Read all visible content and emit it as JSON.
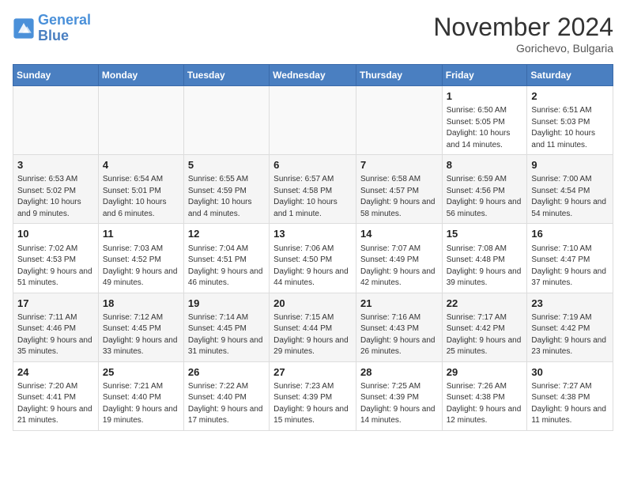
{
  "header": {
    "logo_line1": "General",
    "logo_line2": "Blue",
    "month_title": "November 2024",
    "location": "Gorichevo, Bulgaria"
  },
  "weekdays": [
    "Sunday",
    "Monday",
    "Tuesday",
    "Wednesday",
    "Thursday",
    "Friday",
    "Saturday"
  ],
  "weeks": [
    [
      {
        "day": "",
        "info": ""
      },
      {
        "day": "",
        "info": ""
      },
      {
        "day": "",
        "info": ""
      },
      {
        "day": "",
        "info": ""
      },
      {
        "day": "",
        "info": ""
      },
      {
        "day": "1",
        "info": "Sunrise: 6:50 AM\nSunset: 5:05 PM\nDaylight: 10 hours and 14 minutes."
      },
      {
        "day": "2",
        "info": "Sunrise: 6:51 AM\nSunset: 5:03 PM\nDaylight: 10 hours and 11 minutes."
      }
    ],
    [
      {
        "day": "3",
        "info": "Sunrise: 6:53 AM\nSunset: 5:02 PM\nDaylight: 10 hours and 9 minutes."
      },
      {
        "day": "4",
        "info": "Sunrise: 6:54 AM\nSunset: 5:01 PM\nDaylight: 10 hours and 6 minutes."
      },
      {
        "day": "5",
        "info": "Sunrise: 6:55 AM\nSunset: 4:59 PM\nDaylight: 10 hours and 4 minutes."
      },
      {
        "day": "6",
        "info": "Sunrise: 6:57 AM\nSunset: 4:58 PM\nDaylight: 10 hours and 1 minute."
      },
      {
        "day": "7",
        "info": "Sunrise: 6:58 AM\nSunset: 4:57 PM\nDaylight: 9 hours and 58 minutes."
      },
      {
        "day": "8",
        "info": "Sunrise: 6:59 AM\nSunset: 4:56 PM\nDaylight: 9 hours and 56 minutes."
      },
      {
        "day": "9",
        "info": "Sunrise: 7:00 AM\nSunset: 4:54 PM\nDaylight: 9 hours and 54 minutes."
      }
    ],
    [
      {
        "day": "10",
        "info": "Sunrise: 7:02 AM\nSunset: 4:53 PM\nDaylight: 9 hours and 51 minutes."
      },
      {
        "day": "11",
        "info": "Sunrise: 7:03 AM\nSunset: 4:52 PM\nDaylight: 9 hours and 49 minutes."
      },
      {
        "day": "12",
        "info": "Sunrise: 7:04 AM\nSunset: 4:51 PM\nDaylight: 9 hours and 46 minutes."
      },
      {
        "day": "13",
        "info": "Sunrise: 7:06 AM\nSunset: 4:50 PM\nDaylight: 9 hours and 44 minutes."
      },
      {
        "day": "14",
        "info": "Sunrise: 7:07 AM\nSunset: 4:49 PM\nDaylight: 9 hours and 42 minutes."
      },
      {
        "day": "15",
        "info": "Sunrise: 7:08 AM\nSunset: 4:48 PM\nDaylight: 9 hours and 39 minutes."
      },
      {
        "day": "16",
        "info": "Sunrise: 7:10 AM\nSunset: 4:47 PM\nDaylight: 9 hours and 37 minutes."
      }
    ],
    [
      {
        "day": "17",
        "info": "Sunrise: 7:11 AM\nSunset: 4:46 PM\nDaylight: 9 hours and 35 minutes."
      },
      {
        "day": "18",
        "info": "Sunrise: 7:12 AM\nSunset: 4:45 PM\nDaylight: 9 hours and 33 minutes."
      },
      {
        "day": "19",
        "info": "Sunrise: 7:14 AM\nSunset: 4:45 PM\nDaylight: 9 hours and 31 minutes."
      },
      {
        "day": "20",
        "info": "Sunrise: 7:15 AM\nSunset: 4:44 PM\nDaylight: 9 hours and 29 minutes."
      },
      {
        "day": "21",
        "info": "Sunrise: 7:16 AM\nSunset: 4:43 PM\nDaylight: 9 hours and 26 minutes."
      },
      {
        "day": "22",
        "info": "Sunrise: 7:17 AM\nSunset: 4:42 PM\nDaylight: 9 hours and 25 minutes."
      },
      {
        "day": "23",
        "info": "Sunrise: 7:19 AM\nSunset: 4:42 PM\nDaylight: 9 hours and 23 minutes."
      }
    ],
    [
      {
        "day": "24",
        "info": "Sunrise: 7:20 AM\nSunset: 4:41 PM\nDaylight: 9 hours and 21 minutes."
      },
      {
        "day": "25",
        "info": "Sunrise: 7:21 AM\nSunset: 4:40 PM\nDaylight: 9 hours and 19 minutes."
      },
      {
        "day": "26",
        "info": "Sunrise: 7:22 AM\nSunset: 4:40 PM\nDaylight: 9 hours and 17 minutes."
      },
      {
        "day": "27",
        "info": "Sunrise: 7:23 AM\nSunset: 4:39 PM\nDaylight: 9 hours and 15 minutes."
      },
      {
        "day": "28",
        "info": "Sunrise: 7:25 AM\nSunset: 4:39 PM\nDaylight: 9 hours and 14 minutes."
      },
      {
        "day": "29",
        "info": "Sunrise: 7:26 AM\nSunset: 4:38 PM\nDaylight: 9 hours and 12 minutes."
      },
      {
        "day": "30",
        "info": "Sunrise: 7:27 AM\nSunset: 4:38 PM\nDaylight: 9 hours and 11 minutes."
      }
    ]
  ]
}
